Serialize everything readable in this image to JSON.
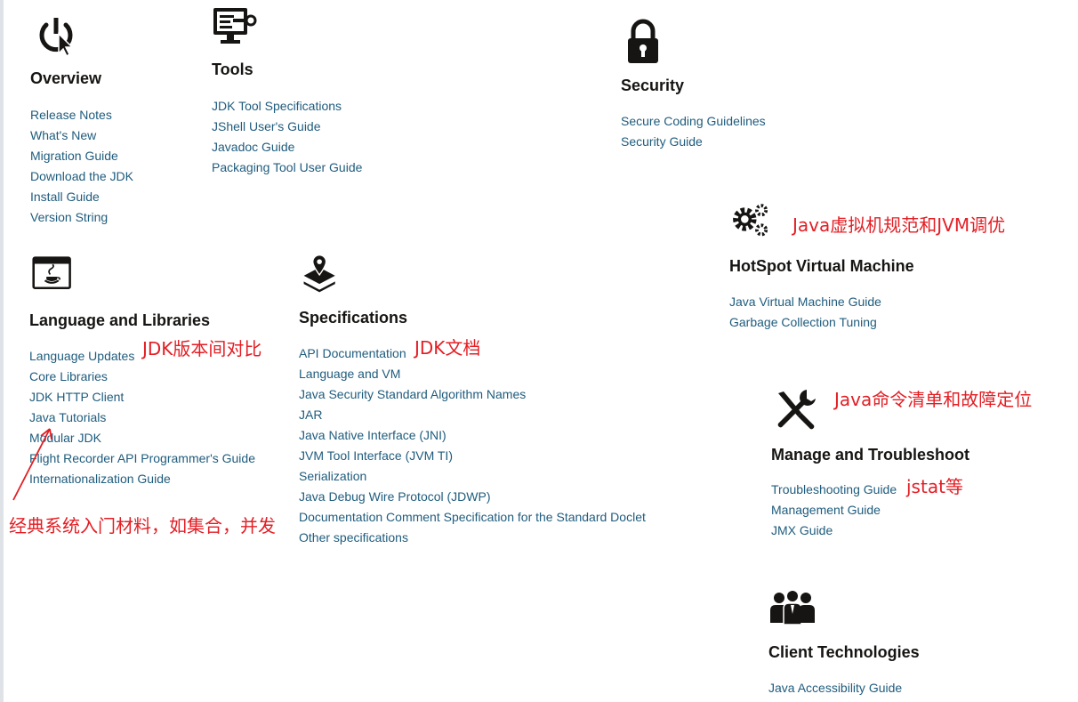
{
  "sections": {
    "overview": {
      "title": "Overview",
      "links": [
        "Release Notes",
        "What's New",
        "Migration Guide",
        "Download the JDK",
        "Install Guide",
        "Version String"
      ]
    },
    "tools": {
      "title": "Tools",
      "links": [
        "JDK Tool Specifications",
        "JShell User's Guide",
        "Javadoc Guide",
        "Packaging Tool User Guide"
      ]
    },
    "security": {
      "title": "Security",
      "links": [
        "Secure Coding Guidelines",
        "Security Guide"
      ]
    },
    "hotspot": {
      "title": "HotSpot Virtual Machine",
      "links": [
        "Java Virtual Machine Guide",
        "Garbage Collection Tuning"
      ]
    },
    "language": {
      "title": "Language and Libraries",
      "links": [
        "Language Updates",
        "Core Libraries",
        "JDK HTTP Client",
        "Java Tutorials",
        "Modular JDK",
        "Flight Recorder API Programmer's Guide",
        "Internationalization Guide"
      ]
    },
    "specifications": {
      "title": "Specifications",
      "links": [
        "API Documentation",
        "Language and VM",
        "Java Security Standard Algorithm Names",
        "JAR",
        "Java Native Interface (JNI)",
        "JVM Tool Interface (JVM TI)",
        "Serialization",
        "Java Debug Wire Protocol (JDWP)",
        "Documentation Comment Specification for the Standard Doclet",
        "Other specifications"
      ]
    },
    "manage": {
      "title": "Manage and Troubleshoot",
      "links": [
        "Troubleshooting Guide",
        "Management Guide",
        "JMX Guide"
      ]
    },
    "client": {
      "title": "Client Technologies",
      "links": [
        "Java Accessibility Guide"
      ]
    }
  },
  "annotations": {
    "jvm_note": "Java虚拟机规范和JVM调优",
    "jdk_version_note": "JDK版本间对比",
    "jdk_doc_note": "JDK文档",
    "command_note": "Java命令清单和故障定位",
    "jstat_note": "jstat等",
    "tutorial_note": "经典系统入门材料，如集合，并发"
  },
  "icons": {
    "overview": "power-cursor-icon",
    "tools": "monitor-key-icon",
    "security": "padlock-icon",
    "hotspot": "gears-icon",
    "language": "java-window-icon",
    "specifications": "layers-pin-icon",
    "manage": "wrench-screwdriver-icon",
    "client": "users-group-icon"
  },
  "colors": {
    "link": "#1f5c7d",
    "title": "#161513",
    "annotation": "#e31e24"
  }
}
